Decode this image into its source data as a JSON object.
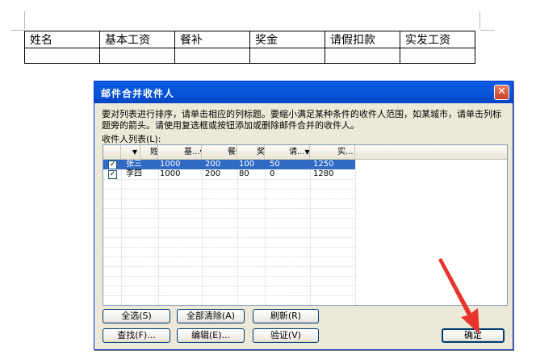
{
  "document": {
    "table_headers": [
      "姓名",
      "基本工资",
      "餐补",
      "奖金",
      "请假扣款",
      "实发工资"
    ]
  },
  "dialog": {
    "title": "邮件合并收件人",
    "close_glyph": "✕",
    "instructions": "要对列表进行排序，请单击相应的列标题。要缩小满足某种条件的收件人范围，如某城市，请单击列标题旁的箭头。请使用复选框或按钮添加或删除邮件合并的收件人。",
    "list_label": "收件人列表(L):",
    "columns": [
      {
        "label": "",
        "arrow": "▼"
      },
      {
        "label": "姓",
        "arrow": "▼"
      },
      {
        "label": "基...",
        "arrow": "▼"
      },
      {
        "label": "餐",
        "arrow": "▼"
      },
      {
        "label": "奖",
        "arrow": "▼"
      },
      {
        "label": "请...",
        "arrow": "▼"
      },
      {
        "label": "实...",
        "arrow": ""
      }
    ],
    "rows": [
      {
        "checked": "✓",
        "name": "张三",
        "base": "1000",
        "meal": "200",
        "bonus": "100",
        "leave": "50",
        "actual": "1250"
      },
      {
        "checked": "✓",
        "name": "李四",
        "base": "1000",
        "meal": "200",
        "bonus": "80",
        "leave": "0",
        "actual": "1280"
      }
    ],
    "buttons": {
      "select_all": "全选(S)",
      "clear_all": "全部清除(A)",
      "refresh": "刷新(R)",
      "find": "查找(F)...",
      "edit": "编辑(E)...",
      "validate": "验证(V)",
      "ok": "确定"
    }
  },
  "colors": {
    "titlebar": "#0851d6",
    "selection": "#316ac5",
    "dialog_bg": "#ece9d8",
    "annotation_arrow": "#e8342c"
  }
}
